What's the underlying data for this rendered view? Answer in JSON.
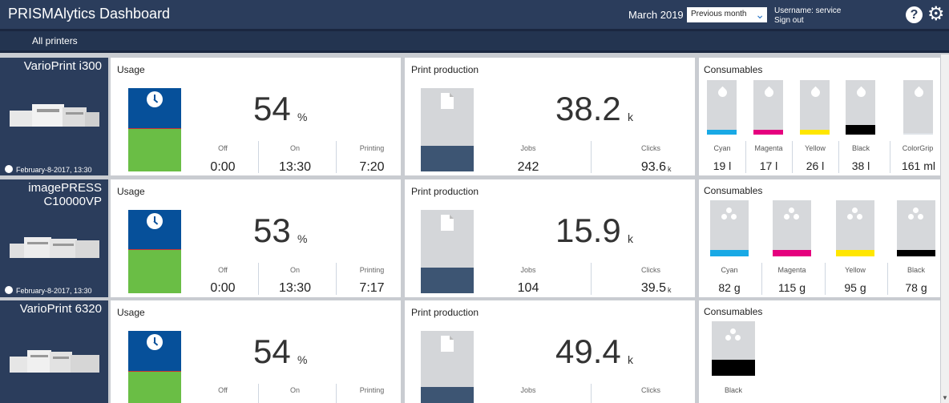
{
  "header": {
    "title": "PRISMAlytics Dashboard",
    "period_label": "March 2019",
    "period_select": "Previous month",
    "username": "Username: service",
    "signout": "Sign out"
  },
  "subnav": {
    "all_printers": "All printers"
  },
  "printers": [
    {
      "name": "VarioPrint i300",
      "date": "February-8-2017, 13:30",
      "usage": {
        "title": "Usage",
        "percent": "54",
        "unit": "%",
        "off_label": "Off",
        "off": "0:00",
        "on_label": "On",
        "on": "13:30",
        "printing_label": "Printing",
        "printing": "7:20",
        "fill": 0.54
      },
      "production": {
        "title": "Print production",
        "value": "38.2",
        "unit": "k",
        "jobs_label": "Jobs",
        "jobs": "242",
        "clicks_label": "Clicks",
        "clicks": "93.6",
        "clicks_unit": "k",
        "fill": 0.3
      },
      "consumables": {
        "title": "Consumables",
        "items": [
          {
            "label": "Cyan",
            "value": "19 l",
            "color": "#19a9e5"
          },
          {
            "label": "Magenta",
            "value": "17 l",
            "color": "#e5007e"
          },
          {
            "label": "Yellow",
            "value": "26 l",
            "color": "#ffe600"
          },
          {
            "label": "Black",
            "value": "38 l",
            "color": "#000000"
          },
          {
            "label": "ColorGrip",
            "value": "161 ml",
            "color": "#dfe3e8"
          }
        ]
      }
    },
    {
      "name": "imagePRESS C10000VP",
      "date": "February-8-2017, 13:30",
      "usage": {
        "title": "Usage",
        "percent": "53",
        "unit": "%",
        "off_label": "Off",
        "off": "0:00",
        "on_label": "On",
        "on": "13:30",
        "printing_label": "Printing",
        "printing": "7:17",
        "fill": 0.53
      },
      "production": {
        "title": "Print production",
        "value": "15.9",
        "unit": "k",
        "jobs_label": "Jobs",
        "jobs": "104",
        "clicks_label": "Clicks",
        "clicks": "39.5",
        "clicks_unit": "k",
        "fill": 0.3
      },
      "consumables": {
        "title": "Consumables",
        "items": [
          {
            "label": "Cyan",
            "value": "82 g",
            "color": "#19a9e5"
          },
          {
            "label": "Magenta",
            "value": "115 g",
            "color": "#e5007e"
          },
          {
            "label": "Yellow",
            "value": "95 g",
            "color": "#ffe600"
          },
          {
            "label": "Black",
            "value": "78 g",
            "color": "#000000"
          }
        ]
      }
    },
    {
      "name": "VarioPrint 6320",
      "usage": {
        "title": "Usage",
        "percent": "54",
        "unit": "%",
        "off_label": "Off",
        "on_label": "On",
        "printing_label": "Printing",
        "fill": 0.54
      },
      "production": {
        "title": "Print production",
        "value": "49.4",
        "unit": "k",
        "jobs_label": "Jobs",
        "clicks_label": "Clicks",
        "fill": 0.3
      },
      "consumables": {
        "title": "Consumables",
        "items": [
          {
            "label": "Black",
            "color": "#000000"
          }
        ]
      }
    }
  ]
}
